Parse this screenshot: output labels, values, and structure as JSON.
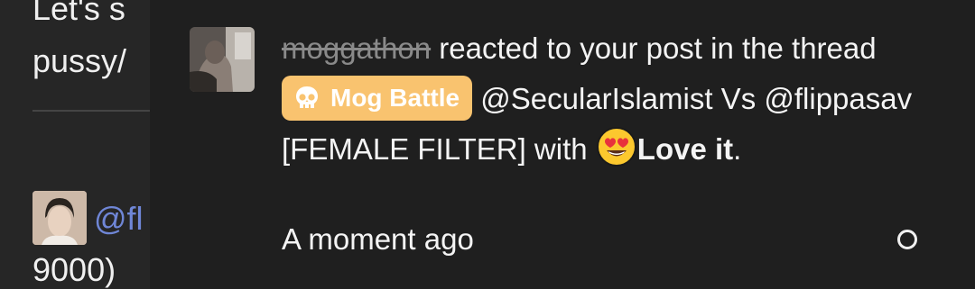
{
  "background_post": {
    "line1": "Let's s",
    "line2": "pussy/",
    "mention": "@fl",
    "line3": "9000)"
  },
  "notification": {
    "username": "moggathon",
    "text_after_user": " reacted to your post in the thread ",
    "badge_label": "Mog Battle",
    "thread_title": " @SecularIslamist Vs @flippasav [FEMALE FILTER] with ",
    "reaction_label": "Love it",
    "reaction_suffix": ".",
    "time": "A moment ago",
    "badge_color": "#f9c36f"
  }
}
